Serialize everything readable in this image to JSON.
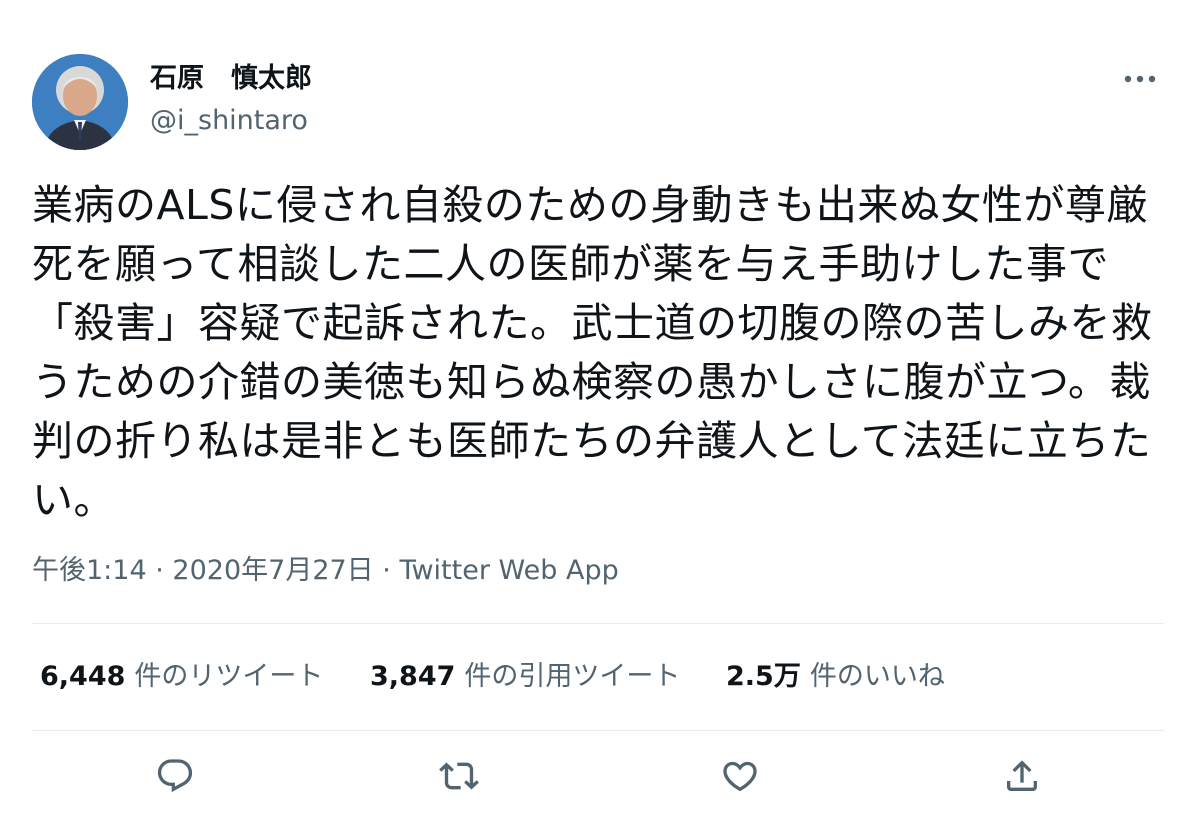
{
  "user": {
    "display_name": "石原　慎太郎",
    "handle": "@i_shintaro"
  },
  "tweet": {
    "text": "業病のALSに侵され自殺のための身動きも出来ぬ女性が尊厳死を願って相談した二人の医師が薬を与え手助けした事で「殺害」容疑で起訴された。武士道の切腹の際の苦しみを救うための介錯の美徳も知らぬ検察の愚かしさに腹が立つ。裁判の折り私は是非とも医師たちの弁護人として法廷に立ちたい。",
    "time": "午後1:14",
    "separator": "·",
    "date": "2020年7月27日",
    "source": "Twitter Web App"
  },
  "stats": {
    "retweets_count": "6,448",
    "retweets_label": "件のリツイート",
    "quotes_count": "3,847",
    "quotes_label": "件の引用ツイート",
    "likes_count": "2.5万",
    "likes_label": "件のいいね"
  },
  "icons": {
    "more": "more-horizontal-icon",
    "reply": "reply-icon",
    "retweet": "retweet-icon",
    "like": "heart-icon",
    "share": "share-icon"
  },
  "colors": {
    "text_primary": "#0f1419",
    "text_secondary": "#536471",
    "divider": "#e6ecf0",
    "avatar_background": "#3d7fc0"
  }
}
